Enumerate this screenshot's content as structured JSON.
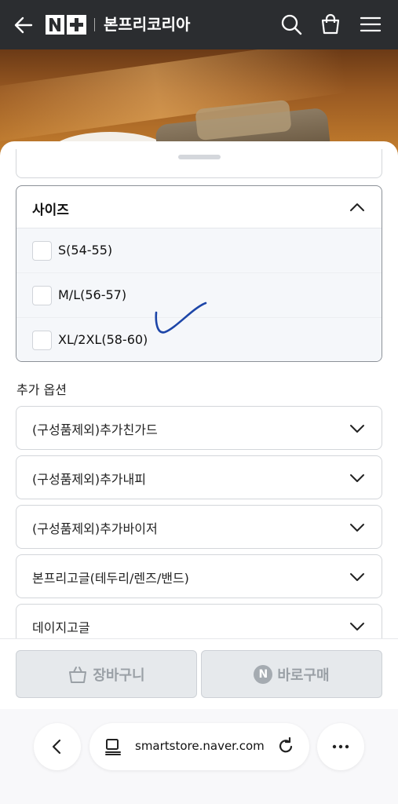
{
  "header": {
    "logo_text": "N+",
    "store_name": "본프리코리아",
    "icons": [
      "back-arrow-icon",
      "search-icon",
      "shopping-bag-icon",
      "menu-icon"
    ]
  },
  "size_section": {
    "label": "사이즈",
    "options": [
      {
        "label": "S(54-55)",
        "checked": false
      },
      {
        "label": "M/L(56-57)",
        "checked": false
      },
      {
        "label": "XL/2XL(58-60)",
        "checked": false
      }
    ]
  },
  "extra_options": {
    "title": "추가 옵션",
    "items": [
      "(구성품제외)추가친가드",
      "(구성품제외)추가내피",
      "(구성품제외)추가바이저",
      "본프리고글(테두리/렌즈/밴드)",
      "데이지고글"
    ]
  },
  "buy_bar": {
    "cart_label": "장바구니",
    "buy_now_label": "바로구매",
    "naver_badge": "N"
  },
  "browser": {
    "url": "smartstore.naver.com"
  },
  "colors": {
    "header_bg": "#2b2d30",
    "disabled_button_bg": "#e6e9ec",
    "annotation_stroke": "#1d46a8"
  }
}
